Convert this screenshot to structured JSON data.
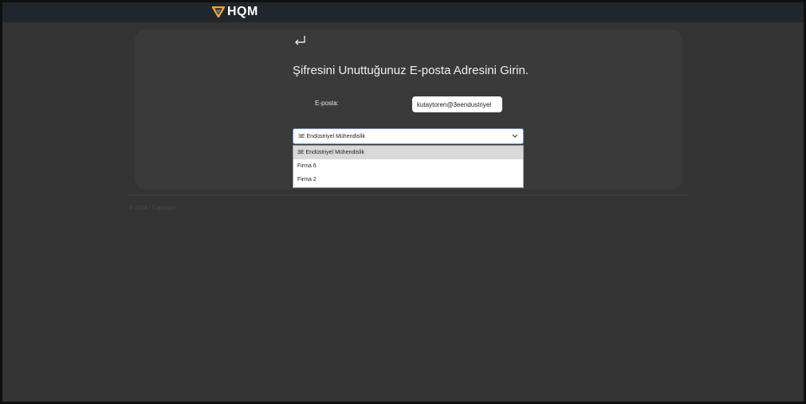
{
  "header": {
    "logo_text": "HQM",
    "logo_icon": "hqm-logo-icon"
  },
  "form": {
    "back_icon": "return-arrow-icon",
    "title": "Şifresini Unuttuğunuz E-posta Adresini Girin.",
    "email_label": "E-posta:",
    "email_value": "kutaytoren@3eendustriyel"
  },
  "company_select": {
    "selected": "3E Endüstriyel Mühendislik",
    "options": [
      "3E Endüstriyel Mühendislik",
      "Firma 6",
      "Firma 2"
    ]
  },
  "footer": {
    "text": "© 2024 - Copyright"
  },
  "colors": {
    "page_background": "#333333",
    "topbar": "#20262d",
    "card": "#3a3a3a",
    "select_border": "#6a8fd8",
    "logo_orange": "#f5a623",
    "logo_blue": "#3b7ddd"
  }
}
